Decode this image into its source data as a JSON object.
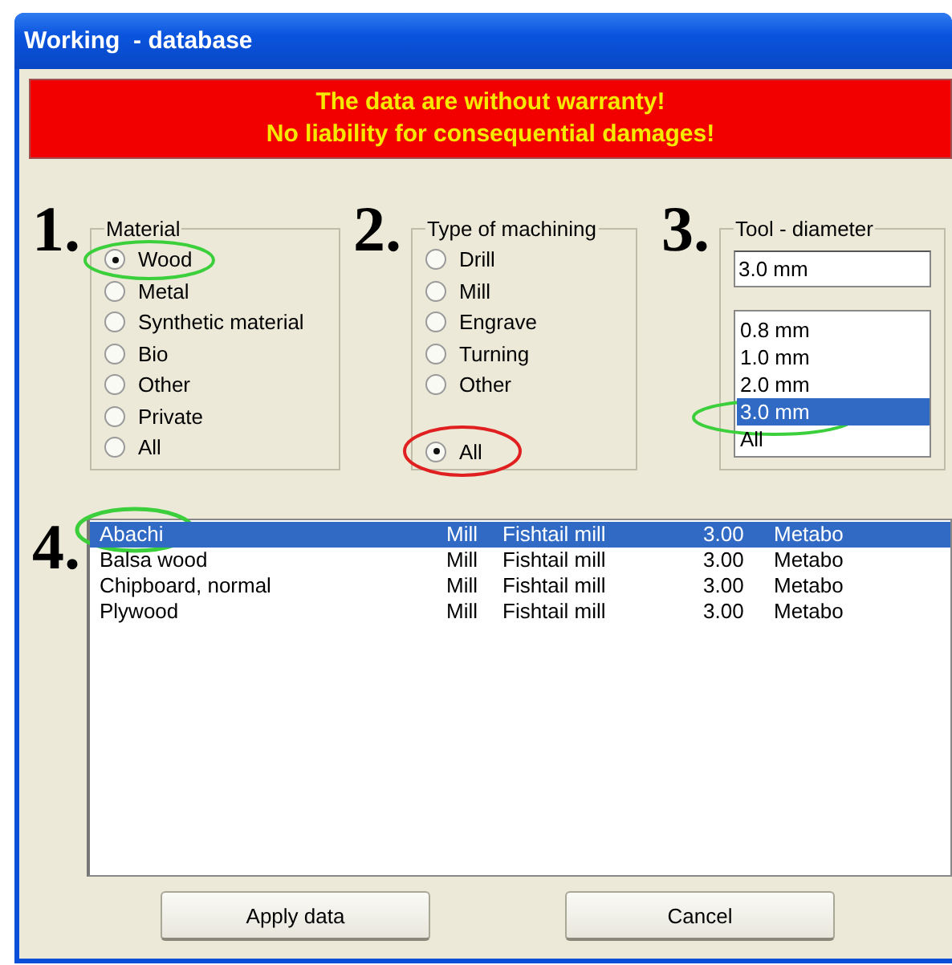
{
  "window": {
    "title": "Working  - database"
  },
  "warning": [
    "The data are without warranty!",
    "No liability for consequential damages!"
  ],
  "material": {
    "step": "1.",
    "legend": "Material",
    "options": [
      {
        "label": "Wood",
        "selected": true
      },
      {
        "label": "Metal",
        "selected": false
      },
      {
        "label": "Synthetic material",
        "selected": false
      },
      {
        "label": "Bio",
        "selected": false
      },
      {
        "label": "Other",
        "selected": false
      },
      {
        "label": "Private",
        "selected": false
      },
      {
        "label": "All",
        "selected": false
      }
    ]
  },
  "machining": {
    "step": "2.",
    "legend": "Type of machining",
    "options": [
      {
        "label": "Drill",
        "selected": false
      },
      {
        "label": "Mill",
        "selected": false
      },
      {
        "label": "Engrave",
        "selected": false
      },
      {
        "label": "Turning",
        "selected": false
      },
      {
        "label": "Other",
        "selected": false
      },
      {
        "label": "All",
        "selected": true
      }
    ]
  },
  "diameter": {
    "step": "3.",
    "legend": "Tool - diameter",
    "value": "3.0 mm",
    "options": [
      {
        "label": "0.8 mm",
        "selected": false
      },
      {
        "label": "1.0 mm",
        "selected": false
      },
      {
        "label": "2.0 mm",
        "selected": false
      },
      {
        "label": "3.0 mm",
        "selected": true
      },
      {
        "label": "All",
        "selected": false
      }
    ]
  },
  "results": {
    "step": "4.",
    "rows": [
      {
        "cells": [
          "Abachi",
          "Mill",
          "Fishtail mill",
          "3.00",
          "Metabo"
        ],
        "selected": true
      },
      {
        "cells": [
          "Balsa wood",
          "Mill",
          "Fishtail mill",
          "3.00",
          "Metabo"
        ],
        "selected": false
      },
      {
        "cells": [
          "Chipboard, normal",
          "Mill",
          "Fishtail mill",
          "3.00",
          "Metabo"
        ],
        "selected": false
      },
      {
        "cells": [
          "Plywood",
          "Mill",
          "Fishtail mill",
          "3.00",
          "Metabo"
        ],
        "selected": false
      }
    ]
  },
  "buttons": [
    "Apply data",
    "Cancel"
  ]
}
